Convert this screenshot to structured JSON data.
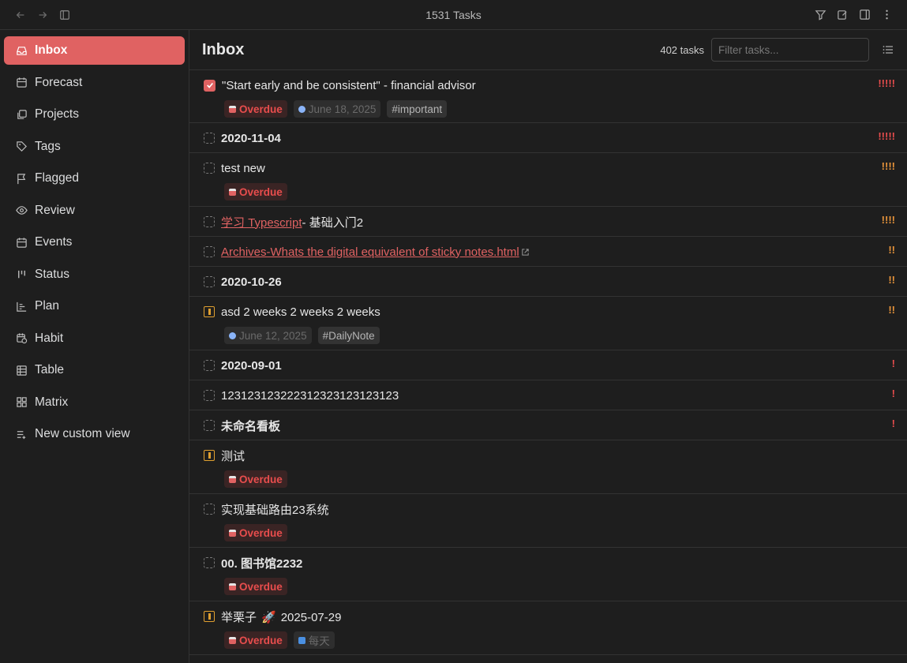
{
  "window": {
    "title": "1531 Tasks"
  },
  "sidebar": {
    "items": [
      {
        "label": "Inbox",
        "icon": "inbox-icon",
        "active": true
      },
      {
        "label": "Forecast",
        "icon": "calendar-icon"
      },
      {
        "label": "Projects",
        "icon": "layers-icon"
      },
      {
        "label": "Tags",
        "icon": "tag-icon"
      },
      {
        "label": "Flagged",
        "icon": "flag-icon"
      },
      {
        "label": "Review",
        "icon": "eye-icon"
      },
      {
        "label": "Events",
        "icon": "calendar-icon"
      },
      {
        "label": "Status",
        "icon": "status-icon"
      },
      {
        "label": "Plan",
        "icon": "chart-icon"
      },
      {
        "label": "Habit",
        "icon": "calendar-clock-icon"
      },
      {
        "label": "Table",
        "icon": "table-icon"
      },
      {
        "label": "Matrix",
        "icon": "grid-icon"
      },
      {
        "label": "New custom view",
        "icon": "list-plus-icon"
      }
    ]
  },
  "main": {
    "title": "Inbox",
    "task_count": "402 tasks",
    "filter_placeholder": "Filter tasks..."
  },
  "tasks": [
    {
      "title": "\"Start early and be consistent\" - financial advisor",
      "priority": "!!!!!",
      "status": "checked",
      "overdue": "Overdue",
      "date": "June 18, 2025",
      "tag": "#important"
    },
    {
      "title": "2020-11-04",
      "priority": "!!!!!"
    },
    {
      "title": "test new",
      "priority": "!!!!",
      "overdue": "Overdue"
    },
    {
      "title_link": "学习 Typescript",
      "title_rest": "- 基础入门2",
      "priority": "!!!!"
    },
    {
      "title_link": "Archives-Whats the digital equivalent of sticky notes.html",
      "priority": "!!"
    },
    {
      "title": "2020-10-26",
      "priority": "!!"
    },
    {
      "title": "asd 2 weeks 2 weeks 2 weeks",
      "priority": "!!",
      "date": "June 12, 2025",
      "tag": "#DailyNote"
    },
    {
      "title": "2020-09-01",
      "priority": "!"
    },
    {
      "title": "123123123222312323123123123",
      "priority": "!"
    },
    {
      "title": "未命名看板",
      "priority": "!"
    },
    {
      "title": "测试",
      "overdue": "Overdue"
    },
    {
      "title": "实现基础路由23系统",
      "overdue": "Overdue"
    },
    {
      "title": "00. 图书馆2232",
      "overdue": "Overdue"
    },
    {
      "title_pre": "举栗子",
      "title_post": "2025-07-29",
      "overdue": "Overdue",
      "repeat": "每天"
    }
  ]
}
